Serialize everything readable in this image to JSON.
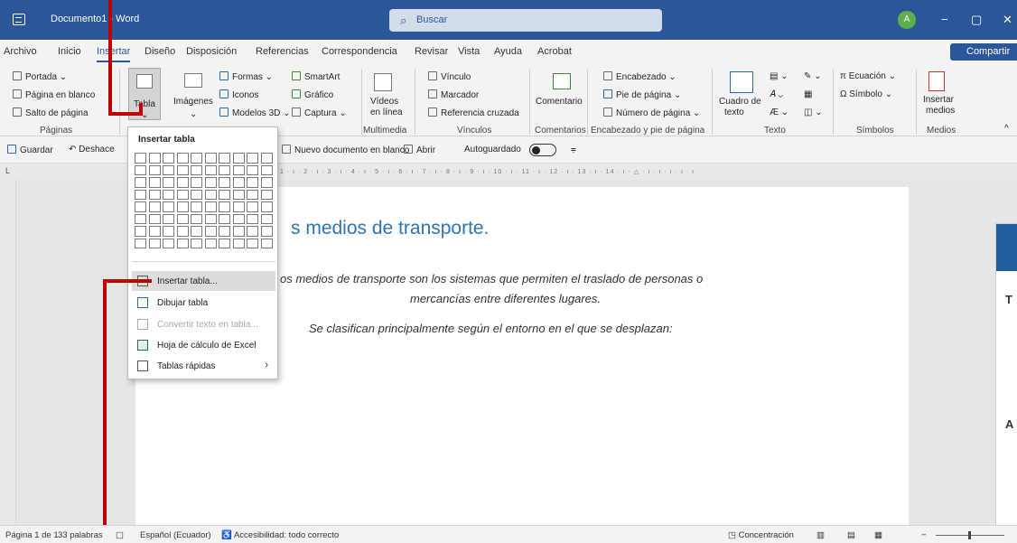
{
  "app": {
    "title": "Documento1 - Word",
    "search_placeholder": "Buscar",
    "avatar_initial": "A",
    "window_controls": [
      "−",
      "▢",
      "✕"
    ]
  },
  "menu": {
    "tabs": [
      "Archivo",
      "Inicio",
      "Insertar",
      "Diseño",
      "Disposición",
      "Referencias",
      "Correspondencia",
      "Revisar",
      "Vista",
      "Ayuda",
      "Acrobat"
    ],
    "active": "Insertar",
    "share": "Compartir"
  },
  "ribbon": {
    "paginas": {
      "portada": "Portada",
      "pagina_blanco": "Página en blanco",
      "salto": "Salto de página",
      "group": "Páginas"
    },
    "tablas": {
      "tabla": "Tabla"
    },
    "ilustraciones": {
      "imagenes": "Imágenes",
      "formas": "Formas",
      "iconos": "Iconos",
      "modelos3d": "Modelos 3D",
      "smartart": "SmartArt",
      "grafico": "Gráfico",
      "captura": "Captura",
      "group_fragment": "nes"
    },
    "multimedia": {
      "videos1": "Vídeos",
      "videos2": "en línea",
      "group": "Multimedia"
    },
    "vinculos": {
      "vinculo": "Vínculo",
      "marcador": "Marcador",
      "referencia": "Referencia cruzada",
      "group": "Vínculos"
    },
    "comentarios": {
      "comentario": "Comentario",
      "group": "Comentarios"
    },
    "encabezado": {
      "encabezado": "Encabezado",
      "pie": "Pie de página",
      "numero": "Número de página",
      "group": "Encabezado y pie de página"
    },
    "texto": {
      "cuadro1": "Cuadro de",
      "cuadro2": "texto",
      "group": "Texto"
    },
    "simbolos": {
      "ecuacion": "Ecuación",
      "simbolo": "Símbolo",
      "group": "Símbolos"
    },
    "medios": {
      "insertar1": "Insertar",
      "insertar2": "medios",
      "group": "Medios"
    }
  },
  "quick_access": {
    "guardar": "Guardar",
    "deshacer": "Deshace",
    "nuevo": "Nuevo documento en blanco",
    "abrir": "Abrir",
    "autoguardado": "Autoguardado",
    "ruler_scale": "1 · ı · 2 · ı · 3 · ı · 4 · ı · 5 · ı · 6 · ı · 7 · ı · 8 · ı · 9 · ı · 10 · ı · 11 · ı · 12 · ı · 13 · ı · 14 · ı · △ · ı · ı · ı · ı · ı"
  },
  "document": {
    "heading": "s medios de transporte.",
    "para1": "os medios de transporte son los sistemas que permiten el traslado de personas o",
    "para2": "mercancías entre diferentes lugares.",
    "para3": "Se clasifican principalmente según el entorno en el que se desplazan:",
    "side_letter1": "T",
    "side_letter2": "A"
  },
  "table_menu": {
    "title": "Insertar tabla",
    "grid_cols": 10,
    "grid_rows": 8,
    "items": [
      {
        "label": "Insertar tabla...",
        "icon": "table-grid-icon",
        "disabled": false
      },
      {
        "label": "Dibujar tabla",
        "icon": "pencil-table-icon",
        "disabled": false
      },
      {
        "label": "Convertir texto en tabla...",
        "icon": "convert-table-icon",
        "disabled": true
      },
      {
        "label": "Hoja de cálculo de Excel",
        "icon": "excel-icon",
        "disabled": false
      },
      {
        "label": "Tablas rápidas",
        "icon": "quick-tables-icon",
        "disabled": false
      }
    ]
  },
  "status": {
    "pagina": "Página 1 de 1",
    "palabras": "33 palabras",
    "idioma": "Español (Ecuador)",
    "accesibilidad": "Accesibilidad: todo correcto",
    "concentracion": "Concentración"
  },
  "colors": {
    "title_bar": "#2b579a",
    "heading": "#2e74b5",
    "annotation": "#c00000"
  }
}
